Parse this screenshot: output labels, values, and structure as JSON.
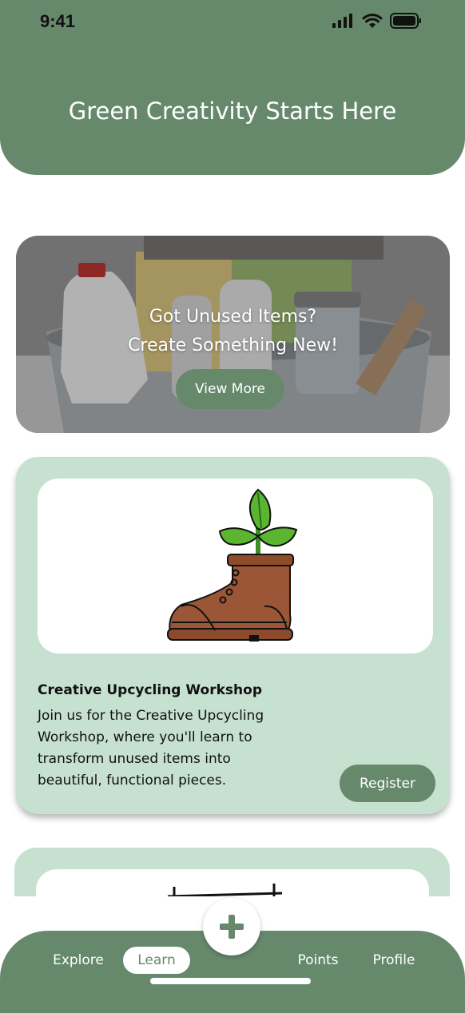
{
  "status_bar": {
    "time": "9:41"
  },
  "header": {
    "title": "Green Creativity Starts Here"
  },
  "promo": {
    "line1": "Got Unused Items?",
    "line2": "Create Something New!",
    "button_label": "View More"
  },
  "event": {
    "title": "Creative Upcycling Workshop",
    "description": "Join us for the Creative Upcycling Workshop, where you'll learn to transform unused items into beautiful, functional pieces.",
    "button_label": "Register",
    "image_icon": "boot-plant-icon"
  },
  "nav": {
    "items": [
      {
        "label": "Explore",
        "active": false
      },
      {
        "label": "Learn",
        "active": true
      },
      {
        "label": "Points",
        "active": false
      },
      {
        "label": "Profile",
        "active": false
      }
    ],
    "fab_icon": "plus-icon"
  },
  "colors": {
    "primary": "#66896c",
    "card": "#c6e1cf",
    "white": "#ffffff"
  }
}
